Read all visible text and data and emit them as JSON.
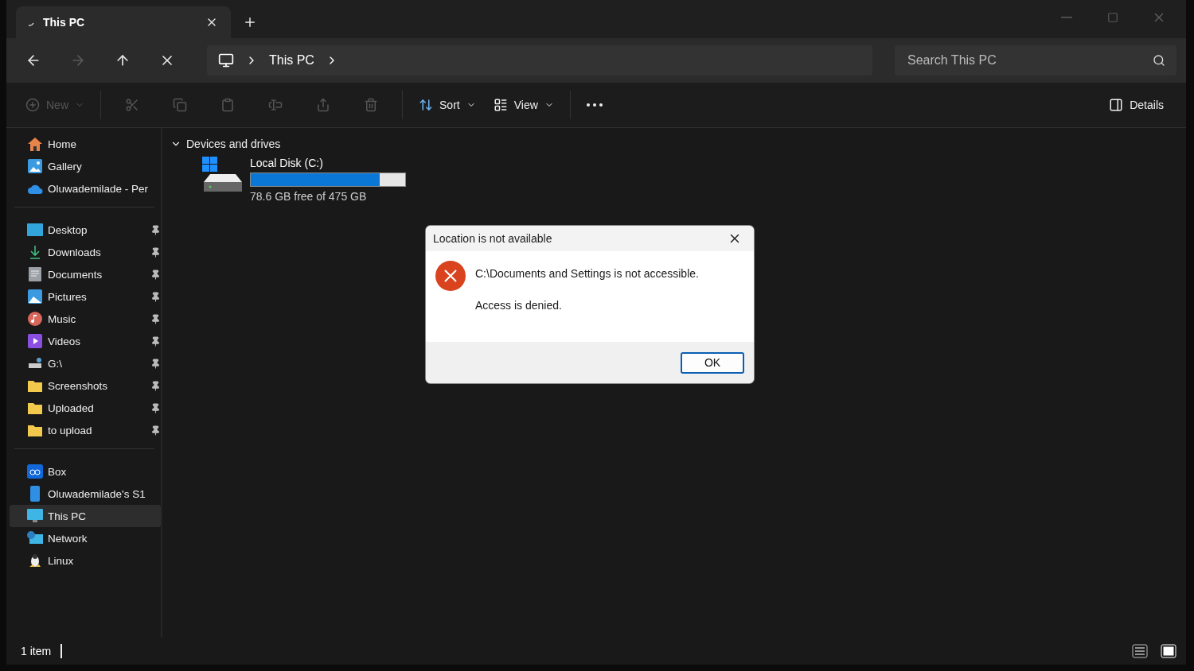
{
  "tab": {
    "title": "This PC"
  },
  "nav": [
    {
      "disabled": false
    },
    {
      "disabled": true
    },
    {
      "disabled": false
    },
    {
      "disabled": false
    }
  ],
  "address": {
    "crumb": "This PC"
  },
  "search": {
    "placeholder": "Search This PC"
  },
  "toolbar": {
    "new": {
      "label": "New",
      "disabled": true
    },
    "actions": [
      {
        "disabled": true
      },
      {
        "disabled": true
      },
      {
        "disabled": true
      },
      {
        "disabled": true
      },
      {
        "disabled": true
      },
      {
        "disabled": true
      }
    ],
    "sort": "Sort",
    "view": "View",
    "details": "Details"
  },
  "sidebar": {
    "groups": [
      [
        {
          "label": "Home",
          "pinned": false,
          "selected": false
        },
        {
          "label": "Gallery",
          "pinned": false,
          "selected": false
        },
        {
          "label": "Oluwademilade - Per",
          "pinned": false,
          "selected": false
        }
      ],
      [
        {
          "label": "Desktop",
          "pinned": true,
          "selected": false
        },
        {
          "label": "Downloads",
          "pinned": true,
          "selected": false
        },
        {
          "label": "Documents",
          "pinned": true,
          "selected": false
        },
        {
          "label": "Pictures",
          "pinned": true,
          "selected": false
        },
        {
          "label": "Music",
          "pinned": true,
          "selected": false
        },
        {
          "label": "Videos",
          "pinned": true,
          "selected": false
        },
        {
          "label": "G:\\",
          "pinned": true,
          "selected": false
        },
        {
          "label": "Screenshots",
          "pinned": true,
          "selected": false
        },
        {
          "label": "Uploaded",
          "pinned": true,
          "selected": false
        },
        {
          "label": "to upload",
          "pinned": true,
          "selected": false
        }
      ],
      [
        {
          "label": "Box",
          "pinned": false,
          "selected": false
        },
        {
          "label": "Oluwademilade's S1",
          "pinned": false,
          "selected": false
        },
        {
          "label": "This PC",
          "pinned": false,
          "selected": true
        },
        {
          "label": "Network",
          "pinned": false,
          "selected": false
        },
        {
          "label": "Linux",
          "pinned": false,
          "selected": false
        }
      ]
    ]
  },
  "section": {
    "title": "Devices and drives",
    "expanded": true
  },
  "drives": [
    {
      "name": "Local Disk (C:)",
      "level": 0.835,
      "free": "78.6 GB free of 475 GB"
    }
  ],
  "status_bar": {
    "count": "1 item",
    "views": [
      {
        "selected": false
      },
      {
        "selected": true
      }
    ]
  },
  "dialog": {
    "title": "Location is not available",
    "message": "C:\\Documents and Settings is not accessible.",
    "detail": "Access is denied.",
    "button": "OK"
  }
}
